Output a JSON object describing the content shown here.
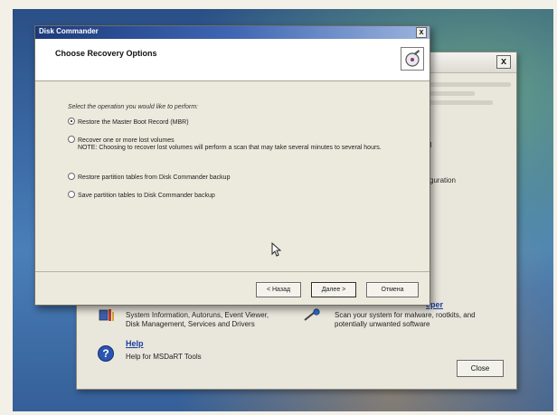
{
  "dialog": {
    "title": "Disk Commander",
    "heading": "Choose Recovery Options",
    "prompt": "Select the operation you would like to perform:",
    "options": [
      {
        "label": "Restore the Master Boot Record (MBR)",
        "selected": true
      },
      {
        "label": "Recover one or more lost volumes",
        "note": "NOTE: Choosing to recover lost volumes will perform a scan that may take several minutes to several hours.",
        "selected": false
      },
      {
        "label": "Restore partition tables from Disk Commander backup",
        "selected": false
      },
      {
        "label": "Save partition tables to Disk Commander backup",
        "selected": false
      }
    ],
    "buttons": {
      "back": "< Назад",
      "next": "Далее >",
      "cancel": "Отмена"
    },
    "close_glyph": "x"
  },
  "background_window": {
    "close_glyph": "x",
    "side_fragments": [
      "ol",
      "figuration",
      "eper"
    ],
    "items": [
      {
        "title": "",
        "desc": "System Information, Autoruns, Event Viewer, Disk Management, Services and Drivers"
      },
      {
        "title": "",
        "desc": "Scan your system for malware, rootkits, and potentially unwanted software"
      },
      {
        "title": "Help",
        "desc": "Help for MSDaRT Tools"
      }
    ],
    "close_label": "Close"
  },
  "colors": {
    "desktop": "#3b6aa5",
    "dialog_title": "#1c3a7a"
  }
}
